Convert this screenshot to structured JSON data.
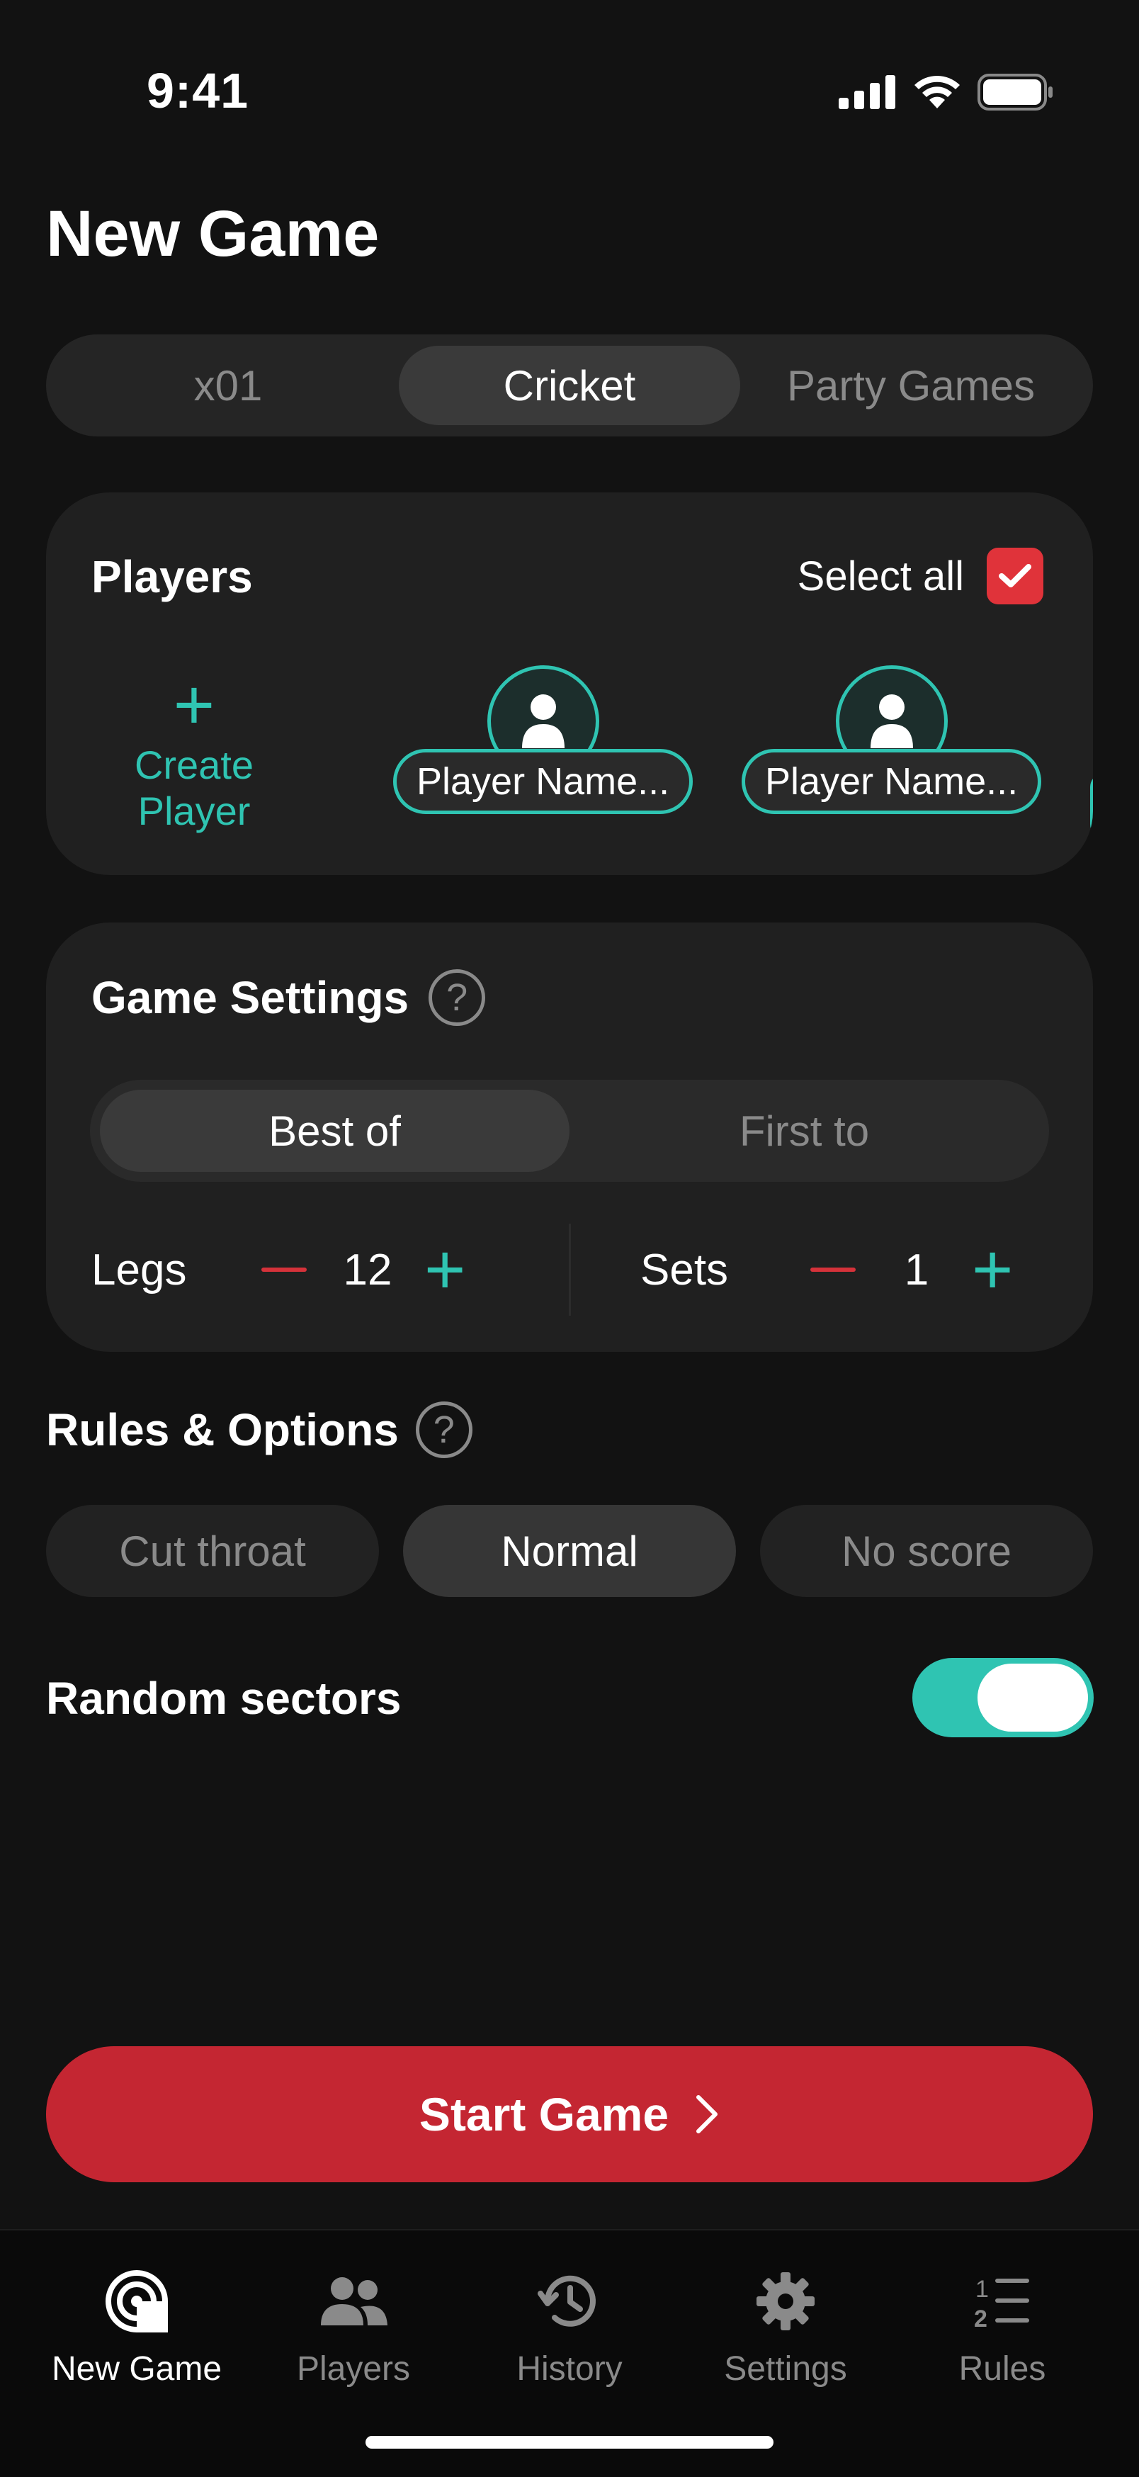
{
  "status": {
    "time": "9:41"
  },
  "page_title": "New Game",
  "game_tabs": [
    "x01",
    "Cricket",
    "Party Games"
  ],
  "game_tabs_active": "Cricket",
  "players": {
    "title": "Players",
    "select_all_label": "Select all",
    "select_all_checked": true,
    "create_label": "Create Player",
    "list": [
      {
        "name": "Player Name..."
      },
      {
        "name": "Player Name..."
      }
    ]
  },
  "game_settings": {
    "title": "Game Settings",
    "modes": [
      "Best of",
      "First to"
    ],
    "mode_active": "Best of",
    "legs": {
      "label": "Legs",
      "value": "12"
    },
    "sets": {
      "label": "Sets",
      "value": "1"
    }
  },
  "rules": {
    "title": "Rules & Options",
    "options": [
      "Cut throat",
      "Normal",
      "No score"
    ],
    "active": "Normal"
  },
  "random_sectors": {
    "label": "Random sectors",
    "enabled": true
  },
  "start_button": "Start Game",
  "tabbar": [
    {
      "label": "New Game",
      "icon": "new-game-icon",
      "active": true
    },
    {
      "label": "Players",
      "icon": "players-icon",
      "active": false
    },
    {
      "label": "History",
      "icon": "history-icon",
      "active": false
    },
    {
      "label": "Settings",
      "icon": "settings-icon",
      "active": false
    },
    {
      "label": "Rules",
      "icon": "rules-icon",
      "active": false
    }
  ],
  "colors": {
    "accent": "#2fc4b2",
    "danger": "#c42632",
    "background": "#121212"
  }
}
